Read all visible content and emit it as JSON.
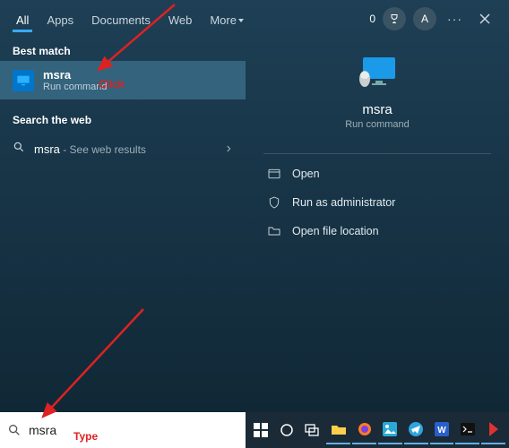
{
  "tabs": {
    "all": "All",
    "apps": "Apps",
    "documents": "Documents",
    "web": "Web",
    "more": "More"
  },
  "topright": {
    "zero": "0",
    "avatar": "A"
  },
  "sections": {
    "best": "Best match",
    "web": "Search the web"
  },
  "best_item": {
    "title": "msra",
    "subtitle": "Run command"
  },
  "web_item": {
    "term": "msra",
    "suffix": " - See web results"
  },
  "preview": {
    "title": "msra",
    "subtitle": "Run command"
  },
  "actions": {
    "open": "Open",
    "admin": "Run as administrator",
    "location": "Open file location"
  },
  "search": {
    "value": "msra"
  },
  "annotations": {
    "click": "Click",
    "type": "Type"
  }
}
